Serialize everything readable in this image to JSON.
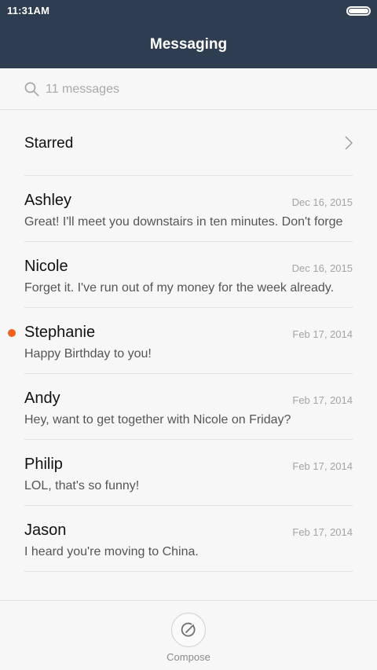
{
  "status_bar": {
    "time": "11:31AM"
  },
  "header": {
    "title": "Messaging"
  },
  "search": {
    "placeholder": "11 messages",
    "icon": "search-icon"
  },
  "starred": {
    "label": "Starred",
    "icon": "chevron-right-icon"
  },
  "conversations": [
    {
      "name": "Ashley",
      "date": "Dec 16, 2015",
      "preview": "Great! I'll meet you downstairs in ten minutes. Don't forge",
      "unread": false
    },
    {
      "name": "Nicole",
      "date": "Dec 16, 2015",
      "preview": "Forget it. I've run out of my money for the week already.",
      "unread": false
    },
    {
      "name": "Stephanie",
      "date": "Feb 17, 2014",
      "preview": "Happy Birthday to you!",
      "unread": true
    },
    {
      "name": "Andy",
      "date": "Feb 17, 2014",
      "preview": "Hey, want to get together with Nicole on Friday?",
      "unread": false
    },
    {
      "name": "Philip",
      "date": "Feb 17, 2014",
      "preview": "LOL, that's so funny!",
      "unread": false
    },
    {
      "name": "Jason",
      "date": "Feb 17, 2014",
      "preview": "I heard you're moving to China.",
      "unread": false
    }
  ],
  "bottom_bar": {
    "compose_label": "Compose",
    "icon": "compose-icon"
  },
  "colors": {
    "header_bg": "#2e3e50",
    "unread_dot": "#f0601e",
    "background": "#f7f7f7"
  }
}
